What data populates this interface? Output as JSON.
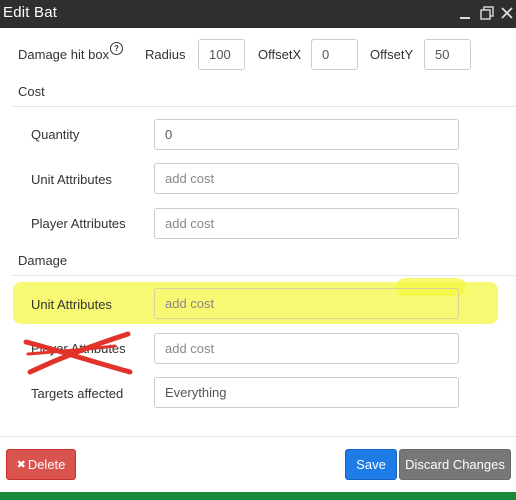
{
  "window": {
    "title": "Edit Bat",
    "minimize_icon": "minimize-icon",
    "maximize_icon": "maximize-icon",
    "close_icon": "close-icon"
  },
  "hitbox": {
    "label": "Damage hit box",
    "help_icon": "?",
    "radius_label": "Radius",
    "radius_value": "100",
    "offsetx_label": "OffsetX",
    "offsetx_value": "0",
    "offsety_label": "OffsetY",
    "offsety_value": "50"
  },
  "cost": {
    "heading": "Cost",
    "quantity_label": "Quantity",
    "quantity_value": "0",
    "unit_attributes_label": "Unit Attributes",
    "unit_attributes_placeholder": "add cost",
    "player_attributes_label": "Player Attributes",
    "player_attributes_placeholder": "add cost"
  },
  "damage": {
    "heading": "Damage",
    "unit_attributes_label": "Unit Attributes",
    "unit_attributes_placeholder": "add cost",
    "player_attributes_label": "Player Attributes",
    "player_attributes_placeholder": "add cost",
    "targets_label": "Targets affected",
    "targets_value": "Everything"
  },
  "footer": {
    "delete_icon": "✖",
    "delete_label": "Delete",
    "save_label": "Save",
    "discard_label": "Discard Changes"
  },
  "colors": {
    "titlebar": "#2f2f2f",
    "delete": "#d9534f",
    "save": "#1e7ce6",
    "discard": "#777777",
    "highlight": "#f5f73c",
    "scribble": "#e2332b"
  }
}
